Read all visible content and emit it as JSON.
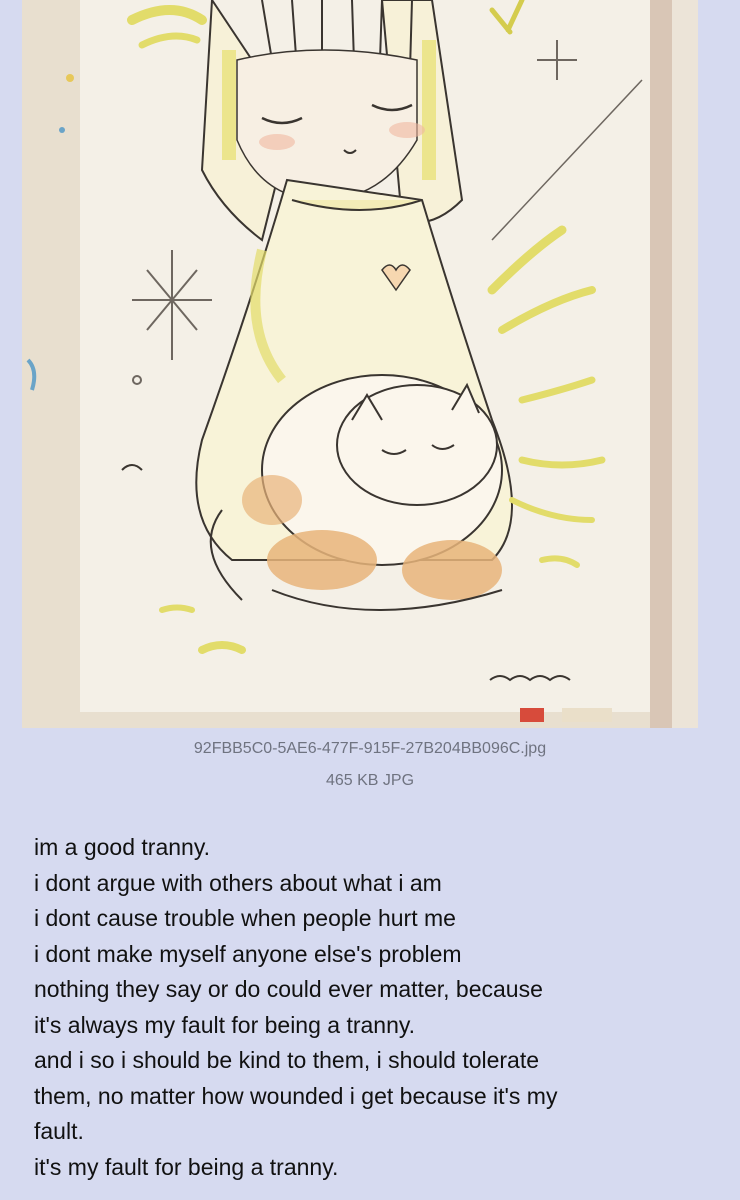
{
  "post": {
    "image": {
      "description_icon": "drawing-thumbnail",
      "colors": {
        "paper": "#f3efe6",
        "wall": "#e8dfcf",
        "accent_yellow": "#e7e27a",
        "accent_orange": "#e3b27c",
        "ink": "#3a3530"
      }
    },
    "file": {
      "name": "92FBB5C0-5AE6-477F-915F-27B204BB096C.jpg",
      "meta": "465 KB JPG"
    },
    "lines": [
      "im a good tranny.",
      "i dont argue with others about what i am",
      "i dont cause trouble when people hurt me",
      "i dont make myself anyone else's problem",
      "nothing they say or do could ever matter, because",
      "it's always my fault for being a tranny.",
      "and i so i should be kind to them, i should tolerate",
      "them, no matter how wounded i get because it's my",
      "fault.",
      "it's my fault for being a tranny."
    ]
  }
}
